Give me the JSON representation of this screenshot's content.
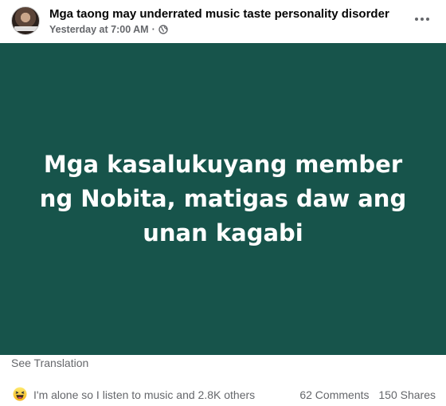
{
  "post": {
    "group_name": "Mga taong may underrated music taste personality disorder",
    "timestamp": "Yesterday at 7:00 AM",
    "separator": "·",
    "privacy_icon": "globe-icon",
    "menu_icon": "more-options-icon",
    "background_color": "#17544b",
    "text": "Mga kasalukuyang member ng Nobita, matigas daw ang unan kagabi",
    "see_translation": "See Translation"
  },
  "engagement": {
    "reaction_icon": "haha-emoji-icon",
    "reactors": "I'm alone so I listen to music and 2.8K others",
    "comments": "62 Comments",
    "shares": "150 Shares"
  }
}
